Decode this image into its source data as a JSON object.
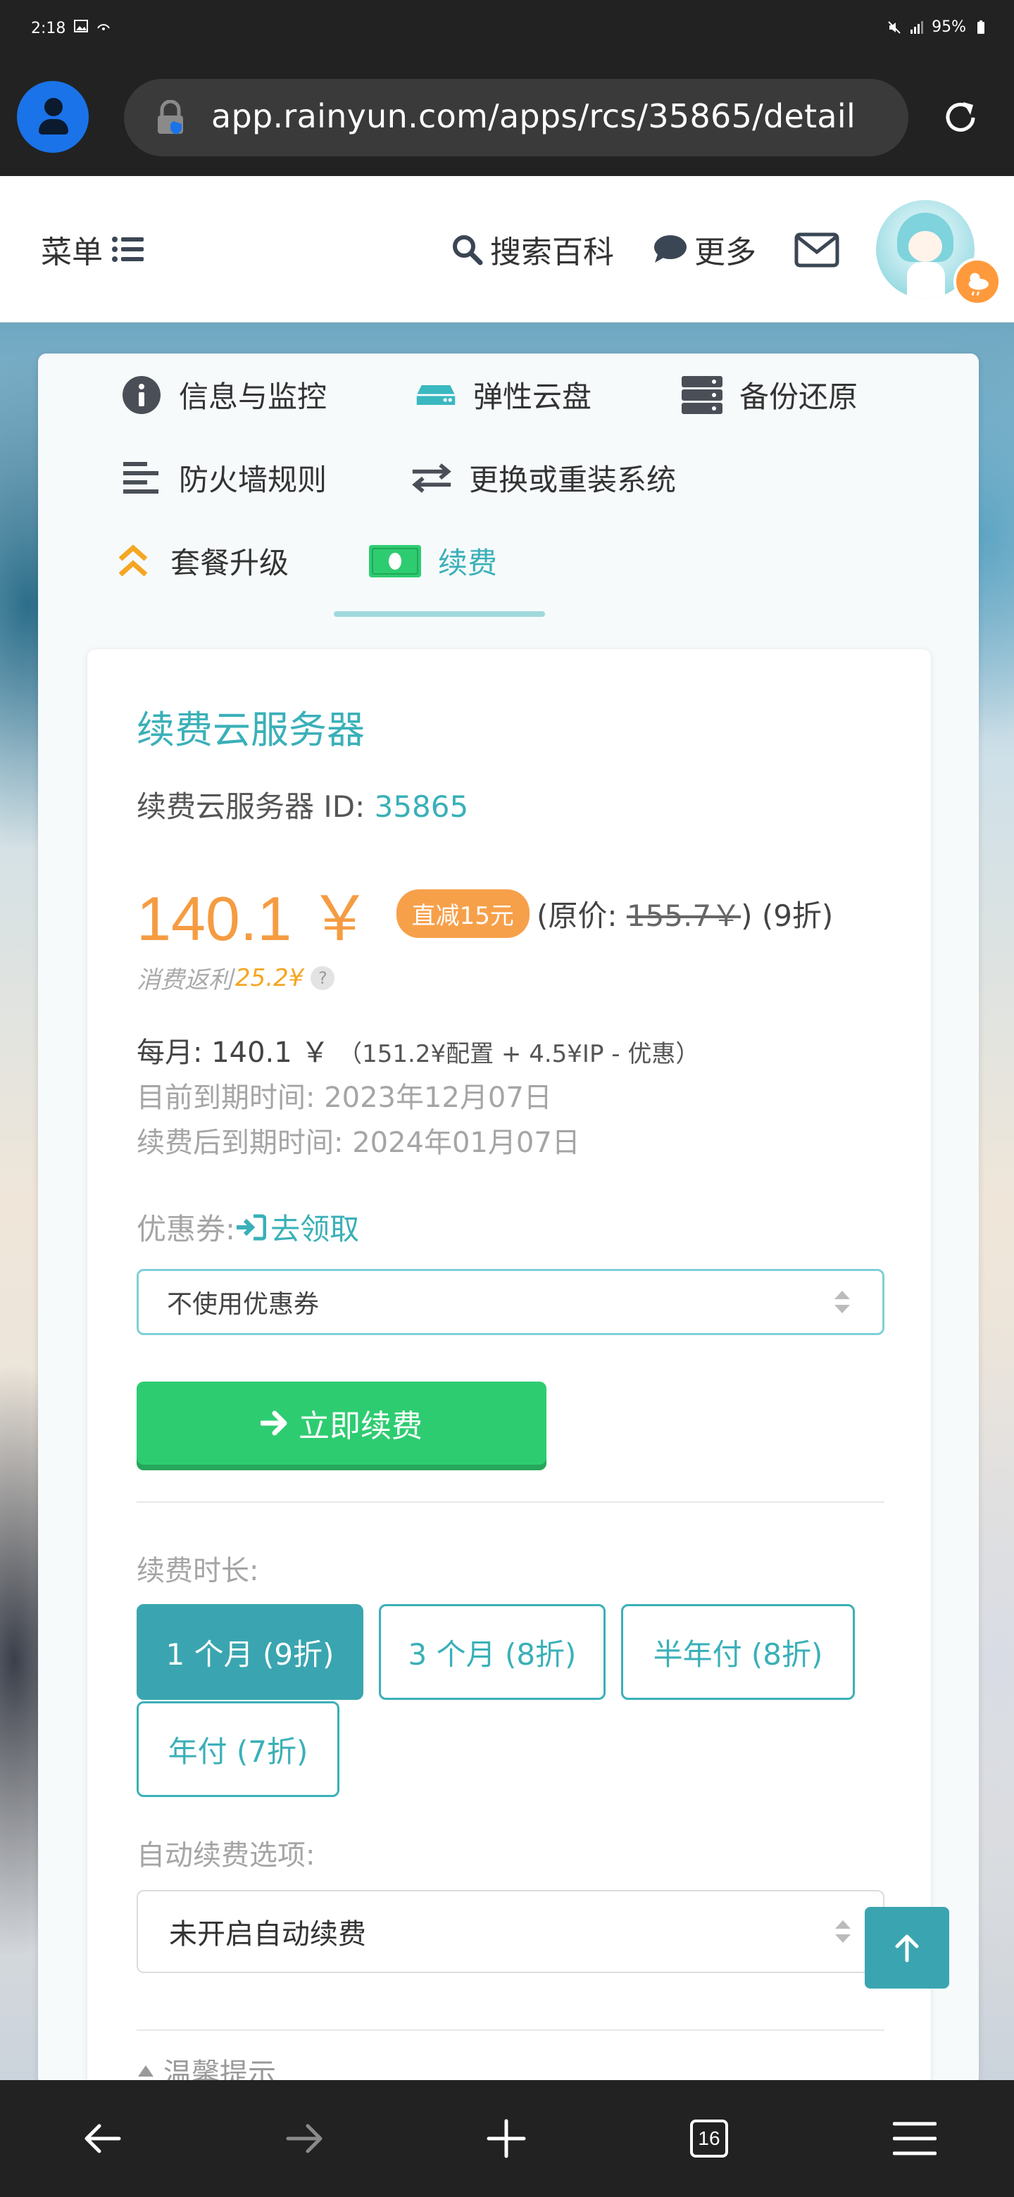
{
  "status_bar": {
    "time": "2:18",
    "battery": "95%"
  },
  "browser": {
    "url": "app.rainyun.com/apps/rcs/35865/detail",
    "tab_count": "16"
  },
  "header": {
    "menu_label": "菜单",
    "search_label": "搜索百科",
    "more_label": "更多"
  },
  "tabs": [
    {
      "label": "信息与监控",
      "icon": "info-circle-icon"
    },
    {
      "label": "弹性云盘",
      "icon": "hdd-icon"
    },
    {
      "label": "备份还原",
      "icon": "server-icon"
    },
    {
      "label": "防火墙规则",
      "icon": "align-left-icon"
    },
    {
      "label": "更换或重装系统",
      "icon": "exchange-icon"
    },
    {
      "label": "套餐升级",
      "icon": "angle-double-up-icon"
    },
    {
      "label": "续费",
      "icon": "money-bill-icon"
    }
  ],
  "renew": {
    "title": "续费云服务器",
    "id_label": "续费云服务器 ID: ",
    "id_value": "35865",
    "price": "140.1 ￥",
    "discount_badge": "直减15元",
    "orig_prefix": "(原价: ",
    "orig_price": "155.7￥",
    "orig_suffix": ") (9折)",
    "rebate_label": "消费返利 ",
    "rebate_value": "25.2¥",
    "help": "?",
    "monthly_label": "每月: 140.1 ￥",
    "monthly_detail": "（151.2¥配置 + 4.5¥IP - 优惠）",
    "expire_now": "目前到期时间: 2023年12月07日",
    "expire_after": "续费后到期时间: 2024年01月07日",
    "coupon_label": "优惠券: ",
    "coupon_claim": "去领取",
    "coupon_select": "不使用优惠券",
    "renew_button": "立即续费",
    "duration_label": "续费时长:",
    "durations": [
      "1 个月 (9折)",
      "3 个月 (8折)",
      "半年付 (8折)",
      "年付 (7折)"
    ],
    "auto_label": "自动续费选项:",
    "auto_select": "未开启自动续费",
    "tips_label": "温馨提示"
  },
  "colors": {
    "accent": "#3ab0b8",
    "price": "#f59c42",
    "button_green": "#2ecc71",
    "browser_bg": "#222222"
  }
}
